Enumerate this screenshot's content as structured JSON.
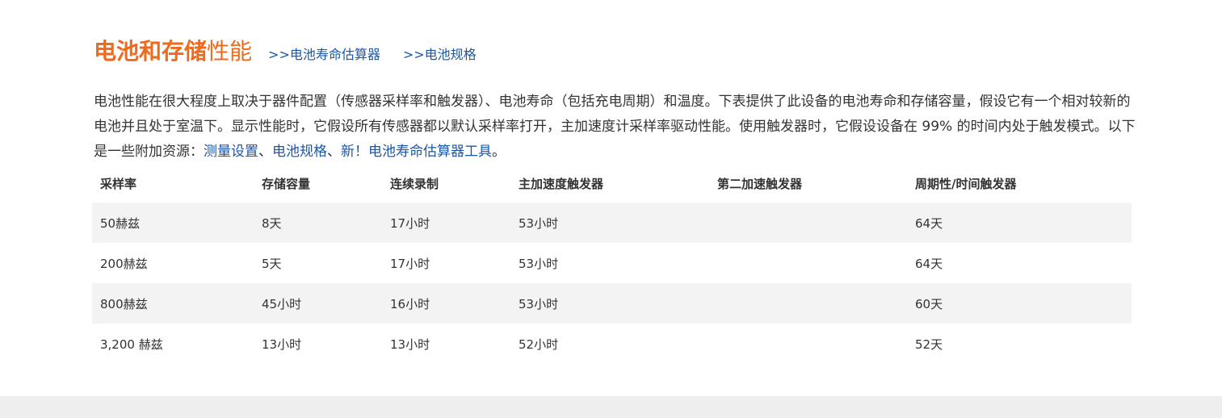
{
  "heading": {
    "title_bold": "电池和存储",
    "title_light": "性能",
    "links": [
      ">>电池寿命估算器",
      ">>电池规格"
    ]
  },
  "description": {
    "text": "电池性能在很大程度上取决于器件配置（传感器采样率和触发器）、电池寿命（包括充电周期）和温度。下表提供了此设备的电池寿命和存储容量，假设它有一个相对较新的电池并且处于室温下。显示性能时，它假设所有传感器都以默认采样率打开，主加速度计采样率驱动性能。使用触发器时，它假设设备在 99% 的时间内处于触发模式。以下是一些附加资源：",
    "link1": "测量设置",
    "sep1": "、",
    "link2": "电池规格",
    "sep2": "、",
    "link3": "新！电池寿命估算器工具",
    "end": "。"
  },
  "table": {
    "headers": [
      "采样率",
      "存储容量",
      "连续录制",
      "主加速度触发器",
      "第二加速触发器",
      "周期性/时间触发器"
    ],
    "rows": [
      [
        "50赫兹",
        "8天",
        "17小时",
        "53小时",
        "",
        "64天"
      ],
      [
        "200赫兹",
        "5天",
        "17小时",
        "53小时",
        "",
        "64天"
      ],
      [
        "800赫兹",
        "45小时",
        "16小时",
        "53小时",
        "",
        "60天"
      ],
      [
        "3,200 赫兹",
        "13小时",
        "13小时",
        "52小时",
        "",
        "52天"
      ]
    ]
  }
}
